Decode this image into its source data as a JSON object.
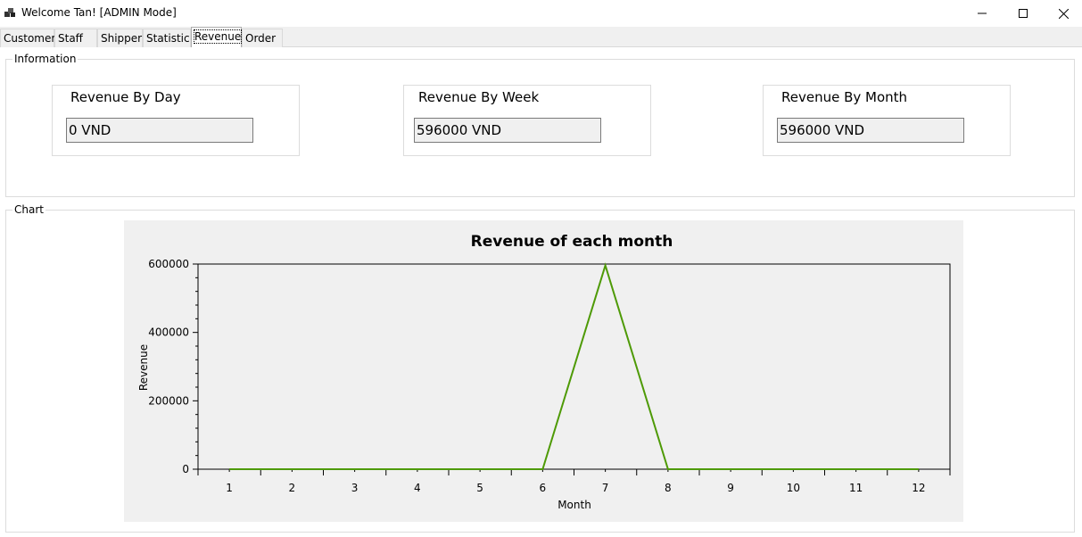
{
  "window": {
    "title": "Welcome Tan! [ADMIN Mode]",
    "controls": [
      "minimize",
      "maximize",
      "close"
    ]
  },
  "tabs": [
    {
      "label": "Customer",
      "active": false
    },
    {
      "label": "Staff",
      "active": false
    },
    {
      "label": "Shipper",
      "active": false
    },
    {
      "label": "Statistic",
      "active": false
    },
    {
      "label": "Revenue",
      "active": true
    },
    {
      "label": "Order",
      "active": false
    }
  ],
  "information": {
    "legend": "Information",
    "cards": [
      {
        "title": "Revenue By Day",
        "value": "0 VND"
      },
      {
        "title": "Revenue By Week",
        "value": "596000 VND"
      },
      {
        "title": "Revenue By Month",
        "value": "596000 VND"
      }
    ]
  },
  "chart_group": {
    "legend": "Chart"
  },
  "chart_data": {
    "type": "line",
    "title": "Revenue of each month",
    "xlabel": "Month",
    "ylabel": "Revenue",
    "x": [
      1,
      2,
      3,
      4,
      5,
      6,
      7,
      8,
      9,
      10,
      11,
      12
    ],
    "series": [
      {
        "values": [
          0,
          0,
          0,
          0,
          0,
          0,
          596000,
          0,
          0,
          0,
          0,
          0
        ],
        "color": "#4e9a06"
      }
    ],
    "xticklabels": [
      "1",
      "2",
      "3",
      "4",
      "5",
      "6",
      "7",
      "8",
      "9",
      "10",
      "11",
      "12"
    ],
    "yticks": [
      0,
      200000,
      400000,
      600000
    ],
    "yticklabels": [
      "0",
      "200000",
      "400000",
      "600000"
    ],
    "xlim": [
      0.5,
      12.5
    ],
    "ylim": [
      0,
      600000
    ],
    "grid": false,
    "legend": "none"
  },
  "colors": {
    "chart_background": "#f0f0f0",
    "series_line": "#4e9a06",
    "window_chrome": "#f0f0f0"
  }
}
